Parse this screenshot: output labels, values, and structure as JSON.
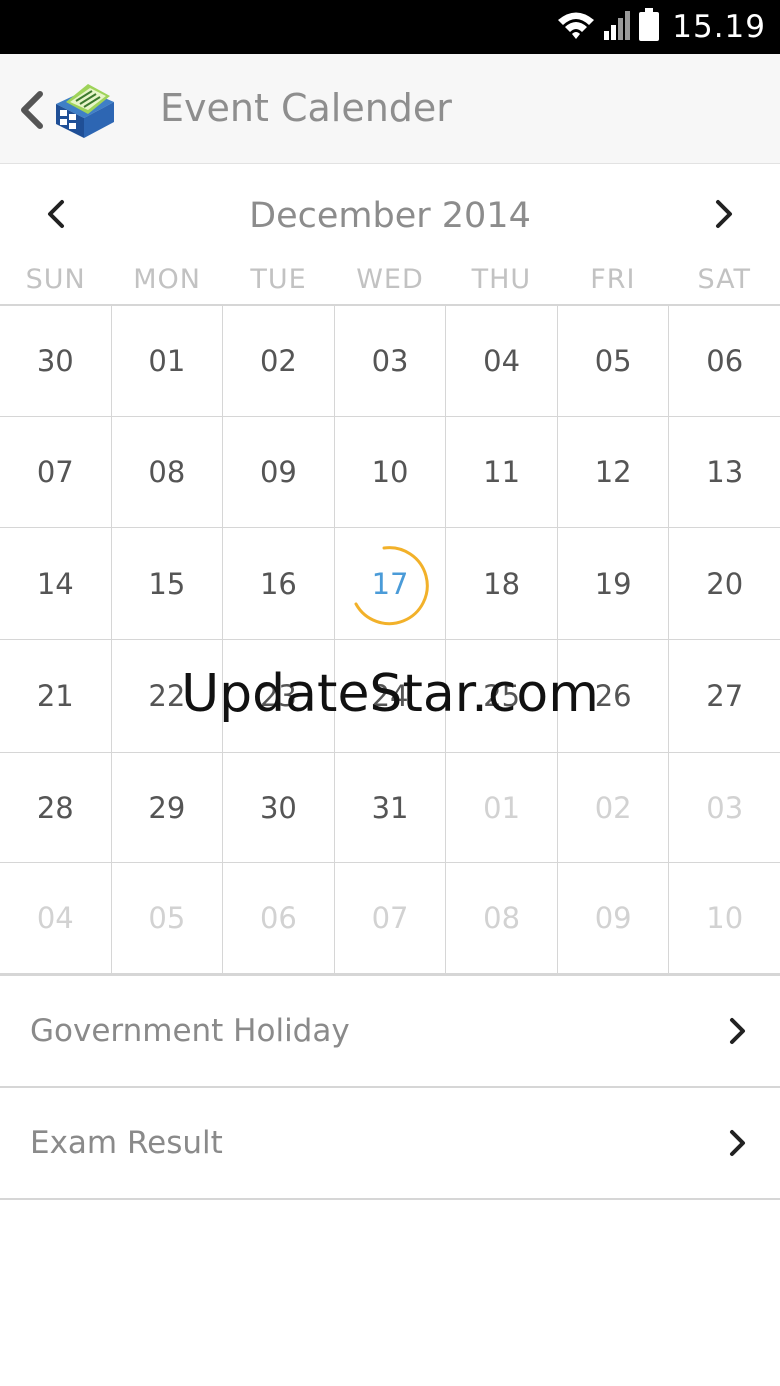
{
  "status": {
    "time": "15.19"
  },
  "header": {
    "title": "Event Calender"
  },
  "calendar": {
    "month_title": "December 2014",
    "weekdays": [
      "SUN",
      "MON",
      "TUE",
      "WED",
      "THU",
      "FRI",
      "SAT"
    ],
    "today": "17",
    "weeks": [
      [
        {
          "d": "30",
          "m": "cur"
        },
        {
          "d": "01",
          "m": "cur"
        },
        {
          "d": "02",
          "m": "cur"
        },
        {
          "d": "03",
          "m": "cur"
        },
        {
          "d": "04",
          "m": "cur"
        },
        {
          "d": "05",
          "m": "cur"
        },
        {
          "d": "06",
          "m": "cur"
        }
      ],
      [
        {
          "d": "07",
          "m": "cur"
        },
        {
          "d": "08",
          "m": "cur"
        },
        {
          "d": "09",
          "m": "cur"
        },
        {
          "d": "10",
          "m": "cur"
        },
        {
          "d": "11",
          "m": "cur"
        },
        {
          "d": "12",
          "m": "cur"
        },
        {
          "d": "13",
          "m": "cur"
        }
      ],
      [
        {
          "d": "14",
          "m": "cur"
        },
        {
          "d": "15",
          "m": "cur"
        },
        {
          "d": "16",
          "m": "cur"
        },
        {
          "d": "17",
          "m": "today"
        },
        {
          "d": "18",
          "m": "cur"
        },
        {
          "d": "19",
          "m": "cur"
        },
        {
          "d": "20",
          "m": "cur"
        }
      ],
      [
        {
          "d": "21",
          "m": "cur"
        },
        {
          "d": "22",
          "m": "cur"
        },
        {
          "d": "23",
          "m": "cur"
        },
        {
          "d": "24",
          "m": "cur"
        },
        {
          "d": "25",
          "m": "cur"
        },
        {
          "d": "26",
          "m": "cur"
        },
        {
          "d": "27",
          "m": "cur"
        }
      ],
      [
        {
          "d": "28",
          "m": "cur"
        },
        {
          "d": "29",
          "m": "cur"
        },
        {
          "d": "30",
          "m": "cur"
        },
        {
          "d": "31",
          "m": "cur"
        },
        {
          "d": "01",
          "m": "other"
        },
        {
          "d": "02",
          "m": "other"
        },
        {
          "d": "03",
          "m": "other"
        }
      ],
      [
        {
          "d": "04",
          "m": "other"
        },
        {
          "d": "05",
          "m": "other"
        },
        {
          "d": "06",
          "m": "other"
        },
        {
          "d": "07",
          "m": "other"
        },
        {
          "d": "08",
          "m": "other"
        },
        {
          "d": "09",
          "m": "other"
        },
        {
          "d": "10",
          "m": "other"
        }
      ]
    ]
  },
  "list": [
    {
      "label": "Government Holiday",
      "icon": "chevron-right-icon"
    },
    {
      "label": "Exam Result",
      "icon": "chevron-right-icon"
    }
  ],
  "watermark": "UpdateStar.com",
  "colors": {
    "today": "#4a9bd8",
    "today_ring": "#f2b12a",
    "muted_text": "#8a8a8a"
  }
}
